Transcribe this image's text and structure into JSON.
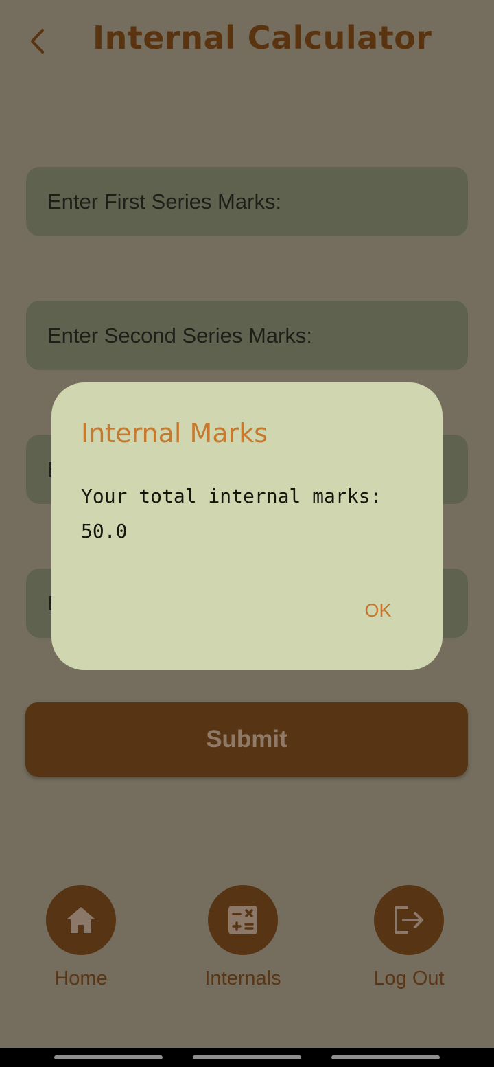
{
  "header": {
    "title": "Internal Calculator",
    "back_icon": "chevron-left-icon"
  },
  "form": {
    "fields": [
      {
        "label": "Enter First Series Marks:"
      },
      {
        "label": "Enter Second Series Marks:"
      },
      {
        "label": "E"
      },
      {
        "label": "E"
      }
    ],
    "submit_label": "Submit"
  },
  "dialog": {
    "title": "Internal Marks",
    "message_line1": "Your total internal marks:",
    "message_line2": "50.0",
    "ok_label": "OK"
  },
  "bottom_nav": [
    {
      "label": "Home",
      "icon": "home-icon"
    },
    {
      "label": "Internals",
      "icon": "calculator-icon"
    },
    {
      "label": "Log Out",
      "icon": "logout-icon"
    }
  ],
  "colors": {
    "background": "#756d5d",
    "brand_brown": "#573413",
    "field": "#5f624f",
    "dialog": "#cfd6b0",
    "accent_orange": "#c77a2e"
  }
}
